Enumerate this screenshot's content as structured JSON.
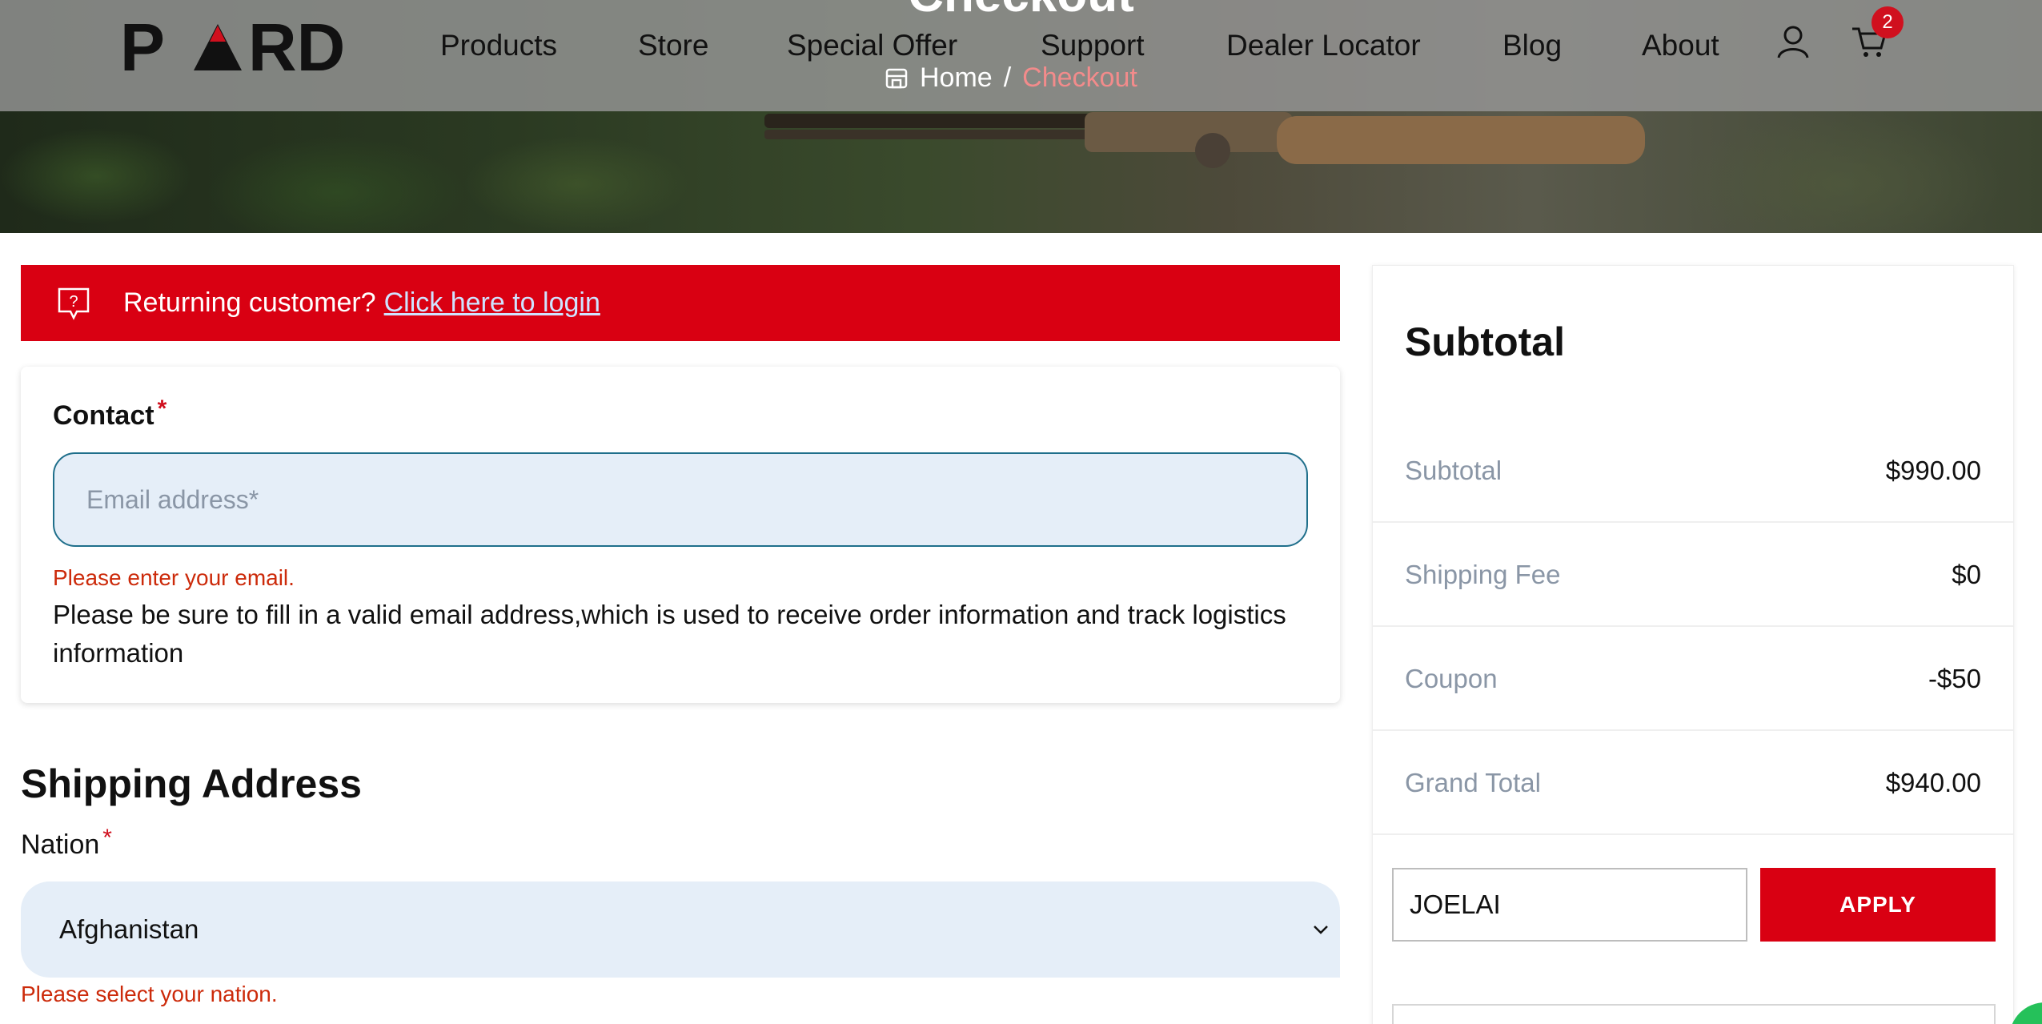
{
  "hero": {
    "title": "Checkout"
  },
  "header": {
    "logo_text": "PARD",
    "nav": [
      "Products",
      "Store",
      "Special Offer",
      "Support",
      "Dealer Locator",
      "Blog",
      "About"
    ],
    "cart_count": "2"
  },
  "breadcrumb": {
    "home": "Home",
    "separator": "/",
    "current": "Checkout"
  },
  "login_banner": {
    "text": "Returning customer?",
    "link": "Click here to login"
  },
  "contact": {
    "label": "Contact",
    "required_mark": "*",
    "email_placeholder": "Email address*",
    "email_error": "Please enter your email.",
    "help_text": "Please be sure to fill in a valid email address,which is used to receive order information and track logistics information"
  },
  "shipping": {
    "title": "Shipping Address",
    "nation_label": "Nation",
    "required_mark": "*",
    "nation_value": "Afghanistan",
    "nation_error": "Please select your nation."
  },
  "summary": {
    "title": "Subtotal",
    "rows": [
      {
        "label": "Subtotal",
        "value": "$990.00"
      },
      {
        "label": "Shipping Fee",
        "value": "$0"
      },
      {
        "label": "Coupon",
        "value": "-$50"
      },
      {
        "label": "Grand Total",
        "value": "$940.00"
      }
    ],
    "coupon_value": "JOELAI",
    "apply_label": "APPLY"
  },
  "colors": {
    "brand_red": "#d90012",
    "input_bg": "#e5eef8",
    "error": "#cc2a0a"
  }
}
